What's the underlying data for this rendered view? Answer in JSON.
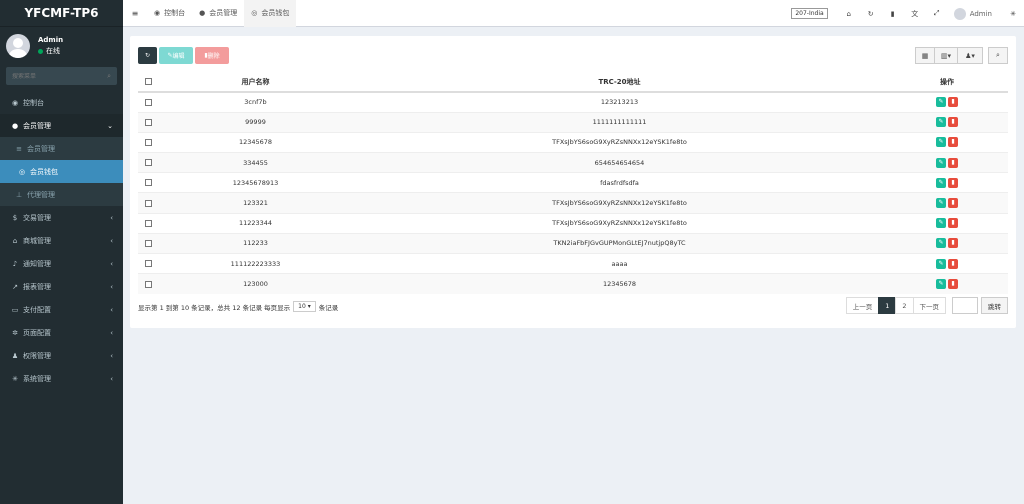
{
  "app": {
    "brand": "YFCMF-TP6"
  },
  "user": {
    "name": "Admin",
    "status": "在线"
  },
  "sidebar": {
    "search_placeholder": "搜索菜单",
    "items": [
      {
        "label": "控制台",
        "icon": "dashboard-icon"
      },
      {
        "label": "会员管理",
        "icon": "user-icon"
      },
      {
        "label": "会员管理",
        "icon": "list-icon"
      },
      {
        "label": "会员钱包",
        "icon": "wallet-icon"
      },
      {
        "label": "代理管理",
        "icon": "sitemap-icon"
      },
      {
        "label": "交易管理",
        "icon": "dollar-icon"
      },
      {
        "label": "商城管理",
        "icon": "home-icon"
      },
      {
        "label": "通知管理",
        "icon": "bell-icon"
      },
      {
        "label": "报表管理",
        "icon": "chart-icon"
      },
      {
        "label": "支付配置",
        "icon": "card-icon"
      },
      {
        "label": "页面配置",
        "icon": "gear-icon"
      },
      {
        "label": "权限管理",
        "icon": "users-icon"
      },
      {
        "label": "系统管理",
        "icon": "cogs-icon"
      }
    ]
  },
  "topbar": {
    "tabs": [
      {
        "label": "控制台",
        "icon": "dashboard-icon"
      },
      {
        "label": "会员管理",
        "icon": "user-icon"
      },
      {
        "label": "会员钱包",
        "icon": "wallet-icon"
      }
    ],
    "region": "207-India",
    "admin": "Admin"
  },
  "toolbar": {
    "edit_label": "编辑",
    "delete_label": "删除"
  },
  "table": {
    "headers": {
      "username": "用户名称",
      "address": "TRC-20地址",
      "actions": "操作"
    },
    "rows": [
      {
        "username": "3cnf7b",
        "address": "123213213"
      },
      {
        "username": "99999",
        "address": "1111111111111"
      },
      {
        "username": "12345678",
        "address": "TFXsJbYS6soG9XyRZsNNXx12eYSK1fe8to"
      },
      {
        "username": "334455",
        "address": "654654654654"
      },
      {
        "username": "12345678913",
        "address": "fdasfrdfsdfa"
      },
      {
        "username": "123321",
        "address": "TFXsJbYS6soG9XyRZsNNXx12eYSK1fe8to"
      },
      {
        "username": "11223344",
        "address": "TFXsJbYS6soG9XyRZsNNXx12eYSK1fe8to"
      },
      {
        "username": "112233",
        "address": "TKN2iaFbFJGvGUPMonGLtEJ7nutjpQ8yTC"
      },
      {
        "username": "111122223333",
        "address": "aaaa"
      },
      {
        "username": "123000",
        "address": "12345678"
      }
    ]
  },
  "footer": {
    "info_prefix": "显示第 1 到第 10 条记录，总共 12 条记录 每页显示",
    "page_size": "10",
    "info_suffix": "条记录"
  },
  "pagination": {
    "prev": "上一页",
    "pages": [
      "1",
      "2"
    ],
    "next": "下一页",
    "go": "跳转"
  }
}
